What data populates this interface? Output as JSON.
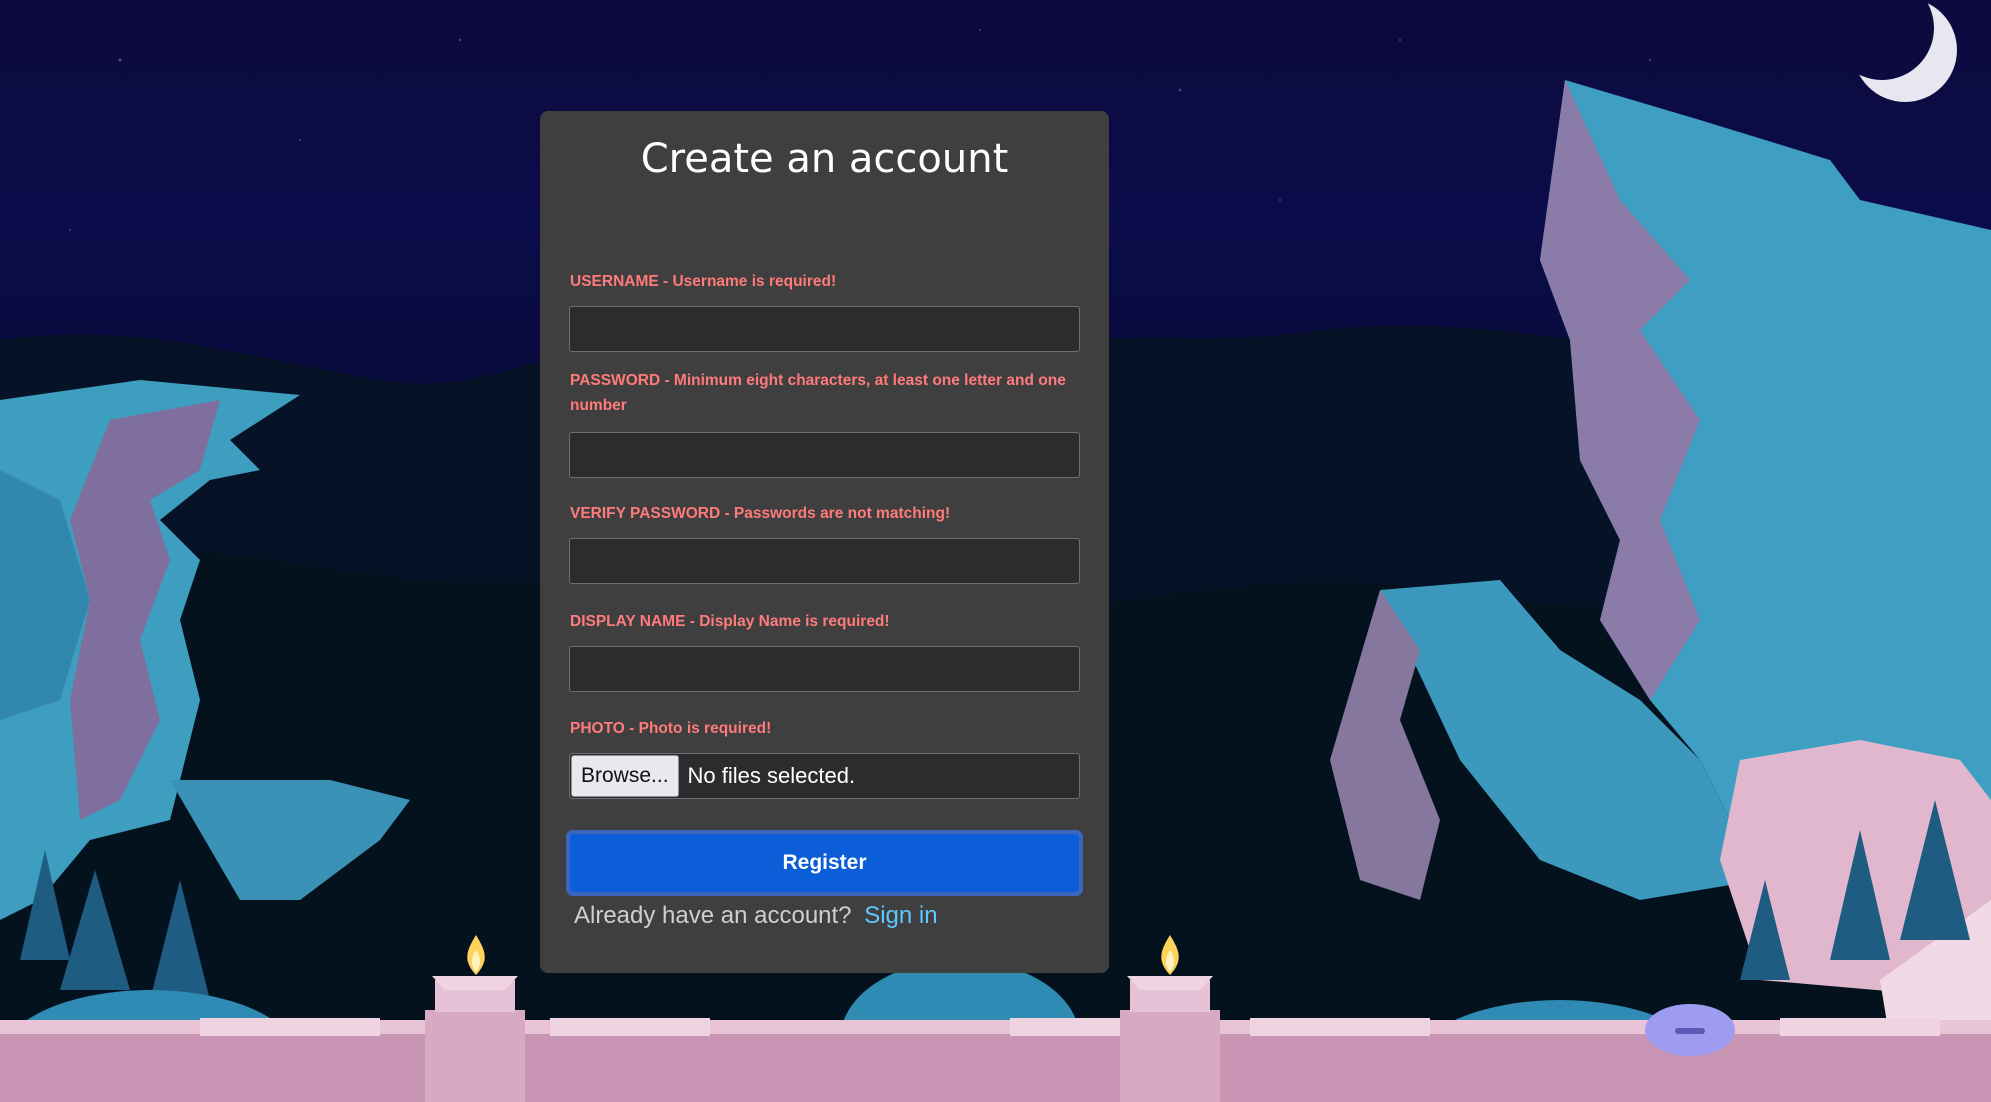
{
  "form": {
    "title": "Create an account",
    "fields": [
      {
        "label": "USERNAME - Username is required!",
        "value": "",
        "type": "text"
      },
      {
        "label": "PASSWORD - Minimum eight characters, at least one letter and one number",
        "value": "",
        "type": "password"
      },
      {
        "label": "VERIFY PASSWORD - Passwords are not matching!",
        "value": "",
        "type": "password"
      },
      {
        "label": "DISPLAY NAME - Display Name is required!",
        "value": "",
        "type": "text"
      }
    ],
    "photo": {
      "label": "PHOTO - Photo is required!",
      "browse_label": "Browse...",
      "status": "No files selected."
    },
    "register_label": "Register",
    "signin_prompt": "Already have an account?",
    "signin_link": "Sign in"
  },
  "colors": {
    "card_bg": "#3f3f3f",
    "error_text": "#ff7b7b",
    "primary_button": "#0b5ed7",
    "link": "#5dc9ff",
    "input_bg": "#2b2c2d"
  },
  "icons": [
    "crescent-moon-icon",
    "candle-flame-icon"
  ]
}
